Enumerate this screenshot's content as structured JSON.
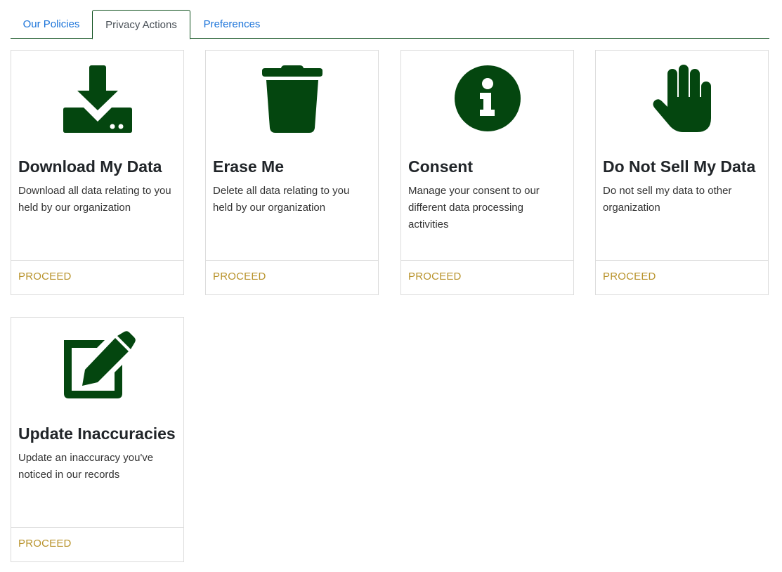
{
  "tabs": [
    {
      "label": "Our Policies"
    },
    {
      "label": "Privacy Actions"
    },
    {
      "label": "Preferences"
    }
  ],
  "active_tab": "Privacy Actions",
  "colors": {
    "icon": "#04460f",
    "proceed": "#b8922a",
    "tab_link": "#1a73d9",
    "tab_border": "#0b4d1a"
  },
  "cards": [
    {
      "icon": "download-icon",
      "title": "Download My Data",
      "description": "Download all data relating to you held by our organization",
      "action": "PROCEED"
    },
    {
      "icon": "trash-icon",
      "title": "Erase Me",
      "description": "Delete all data relating to you held by our organization",
      "action": "PROCEED"
    },
    {
      "icon": "info-icon",
      "title": "Consent",
      "description": "Manage your consent to our different data processing activities",
      "action": "PROCEED"
    },
    {
      "icon": "hand-icon",
      "title": "Do Not Sell My Data",
      "description": "Do not sell my data to other organization",
      "action": "PROCEED"
    },
    {
      "icon": "edit-icon",
      "title": "Update Inaccuracies",
      "description": "Update an inaccuracy you've noticed in our records",
      "action": "PROCEED"
    }
  ]
}
